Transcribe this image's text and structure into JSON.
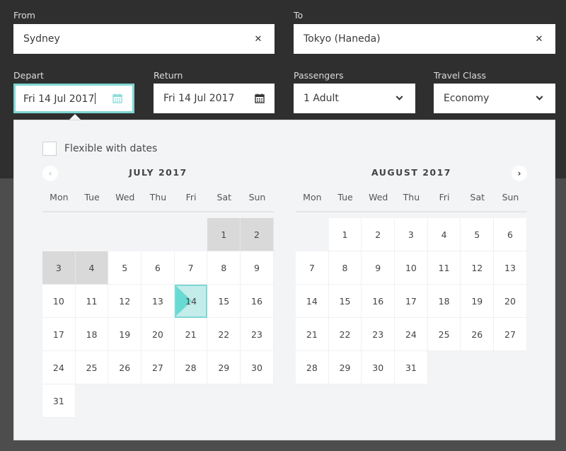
{
  "search": {
    "from": {
      "label": "From",
      "value": "Sydney",
      "clear_icon": "close-icon"
    },
    "to": {
      "label": "To",
      "value": "Tokyo (Haneda)",
      "clear_icon": "close-icon"
    },
    "depart": {
      "label": "Depart",
      "value": "Fri 14 Jul 2017",
      "icon": "calendar-icon"
    },
    "return": {
      "label": "Return",
      "value": "Fri 14 Jul 2017",
      "icon": "calendar-icon"
    },
    "passengers": {
      "label": "Passengers",
      "value": "1 Adult",
      "icon": "chevron-down-icon"
    },
    "travel_class": {
      "label": "Travel Class",
      "value": "Economy",
      "icon": "chevron-down-icon"
    }
  },
  "datepicker": {
    "flexible_label": "Flexible with dates",
    "flexible_checked": false,
    "prev_icon": "chevron-left-icon",
    "next_icon": "chevron-right-icon",
    "weekdays": [
      "Mon",
      "Tue",
      "Wed",
      "Thu",
      "Fri",
      "Sat",
      "Sun"
    ],
    "months": [
      {
        "title": "JULY 2017",
        "leading_blanks": 5,
        "days": 31,
        "disabled_days": [
          1,
          2,
          3,
          4
        ],
        "selected_day": 14
      },
      {
        "title": "AUGUST 2017",
        "leading_blanks": 1,
        "days": 31,
        "disabled_days": [],
        "selected_day": null
      }
    ]
  }
}
